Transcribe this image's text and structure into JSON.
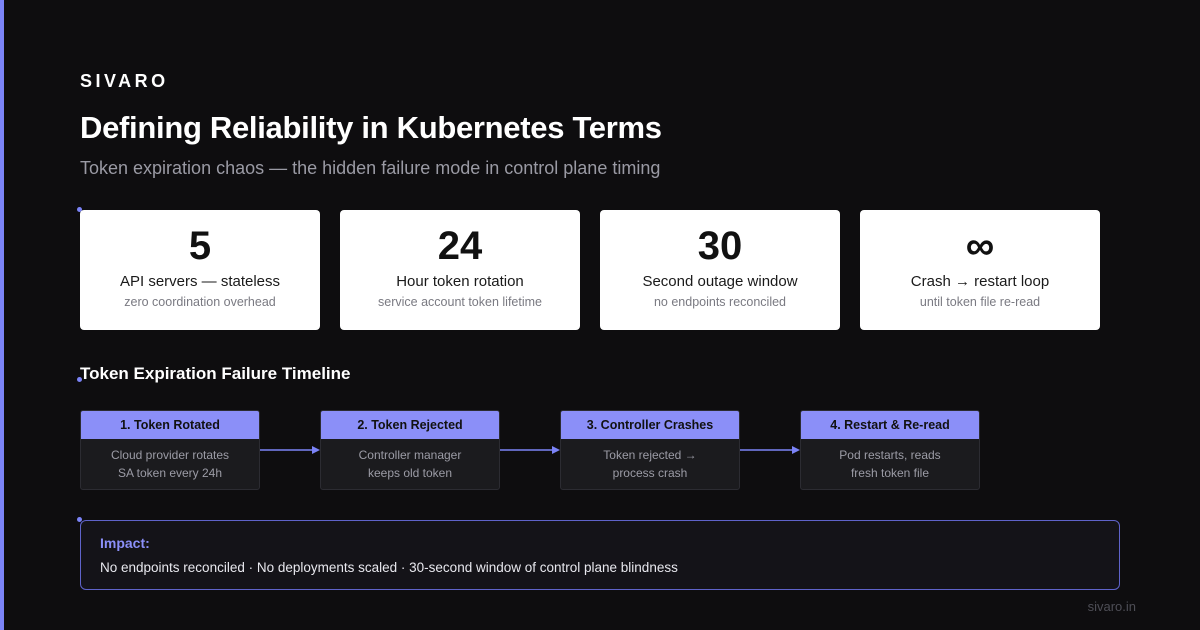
{
  "colors": {
    "background": "#0e0d0f",
    "accent": "#7b83f7",
    "step_header": "#8b8ff8",
    "card": "#ffffff"
  },
  "brand": "SIVARO",
  "title": "Defining Reliability in Kubernetes Terms",
  "subtitle": "Token expiration chaos — the hidden failure mode in control plane timing",
  "stats": [
    {
      "value": "5",
      "label": "API servers — stateless",
      "sub": "zero coordination overhead"
    },
    {
      "value": "24",
      "label": "Hour token rotation",
      "sub": "service account token lifetime"
    },
    {
      "value": "30",
      "label": "Second outage window",
      "sub": "no endpoints reconciled"
    },
    {
      "value": "∞",
      "label": "Crash → restart loop",
      "sub": "until token file re-read"
    }
  ],
  "timeline": {
    "title": "Token Expiration Failure Timeline",
    "steps": [
      {
        "title": "1. Token Rotated",
        "line1": "Cloud provider rotates",
        "line2": "SA token every 24h"
      },
      {
        "title": "2. Token Rejected",
        "line1": "Controller manager",
        "line2": "keeps old token"
      },
      {
        "title": "3. Controller Crashes",
        "line1": "Token rejected →",
        "line2": "process crash"
      },
      {
        "title": "4. Restart & Re-read",
        "line1": "Pod restarts, reads",
        "line2": "fresh token file"
      }
    ]
  },
  "impact": {
    "label": "Impact:",
    "text": "No endpoints reconciled · No deployments scaled · 30-second window of control plane blindness"
  },
  "footer": "sivaro.in"
}
